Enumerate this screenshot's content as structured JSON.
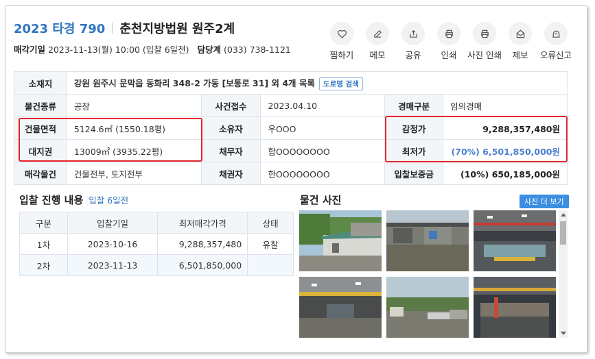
{
  "header": {
    "case_no": "2023 타경 790",
    "court": "춘천지방법원 원주2계",
    "sale_date_label": "매각기일",
    "sale_date_value": "2023-11-13(월) 10:00 (입찰 6일전)",
    "manager_label": "담당계",
    "manager_phone": "(033) 738-1121"
  },
  "actions": [
    {
      "label": "찜하기",
      "icon": "heart-icon"
    },
    {
      "label": "메모",
      "icon": "pencil-icon"
    },
    {
      "label": "공유",
      "icon": "share-icon"
    },
    {
      "label": "인쇄",
      "icon": "printer-icon"
    },
    {
      "label": "사진 인쇄",
      "icon": "photo-print-icon"
    },
    {
      "label": "제보",
      "icon": "report-icon"
    },
    {
      "label": "오류신고",
      "icon": "error-report-icon"
    }
  ],
  "info": {
    "address_label": "소재지",
    "address_value": "강원 원주시 문막읍 동화리 348-2 가동 [보통로 31] 외 4개 목록",
    "road_btn": "도로명 검색",
    "type_label": "물건종류",
    "type_value": "공장",
    "received_label": "사건접수",
    "received_value": "2023.04.10",
    "auction_kind_label": "경매구분",
    "auction_kind_value": "임의경매",
    "building_area_label": "건물면적",
    "building_area_value": "5124.6㎡ (1550.18평)",
    "owner_label": "소유자",
    "owner_value": "우OOO",
    "appraisal_label": "감정가",
    "appraisal_value": "9,288,357,480원",
    "land_right_label": "대지권",
    "land_right_value": "13009㎡ (3935.22평)",
    "debtor_label": "채무자",
    "debtor_value": "합OOOOOOOO",
    "min_price_label": "최저가",
    "min_price_pct": "(70%)",
    "min_price_value": "6,501,850,000원",
    "sale_item_label": "매각물건",
    "sale_item_value": "건물전부, 토지전부",
    "creditor_label": "채권자",
    "creditor_value": "한OOOOOOOO",
    "deposit_label": "입찰보증금",
    "deposit_value": "(10%) 650,185,000원"
  },
  "bid_section": {
    "title": "입찰 진행 내용",
    "subtitle": "입찰 6일전",
    "columns": [
      "구분",
      "입찰기일",
      "최저매각가격",
      "상태"
    ],
    "rows": [
      [
        "1차",
        "2023-10-16",
        "9,288,357,480",
        "유찰"
      ],
      [
        "2차",
        "2023-11-13",
        "6,501,850,000",
        ""
      ]
    ]
  },
  "photo_section": {
    "title": "물건 사진",
    "more_btn": "사진 더 보기"
  },
  "colors": {
    "accent": "#2f74c0",
    "highlight": "#e3262b",
    "header_bg": "#f3f6f9"
  }
}
